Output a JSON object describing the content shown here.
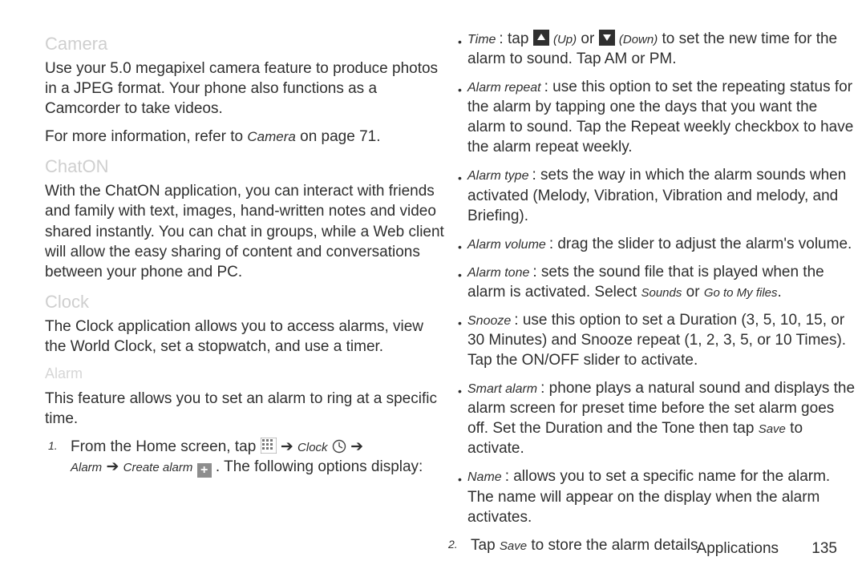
{
  "left": {
    "camera_h": "Camera",
    "camera_p": "Use your 5.0 megapixel camera feature to produce photos in a JPEG format. Your phone also functions as a Camcorder to take videos.",
    "camera_ref_a": "For more information, refer to ",
    "camera_ref_link": "Camera",
    "camera_ref_b": " on page 71.",
    "chaton_h": "ChatON",
    "chaton_p": "With the ChatON application, you can interact with friends and family with text, images, hand-written notes and video shared instantly. You can chat in groups, while a Web client will allow the easy sharing of content and conversations between your phone and PC.",
    "clock_h": "Clock",
    "clock_p": "The Clock application allows you to access alarms, view the World Clock, set a stopwatch, and use a timer.",
    "alarm_h": "Alarm",
    "alarm_p": "This feature allows you to set an alarm to ring at a specific time.",
    "step1_num": "1.",
    "step1_a": "From the Home screen, tap ",
    "step1_clock": "Clock",
    "step1_alarm": "Alarm",
    "step1_arrow": " ➔ ",
    "step1_create": "Create alarm",
    "step1_b": ". The following options display:"
  },
  "right": {
    "time_lead": "Time",
    "time_a": ": tap ",
    "time_up": " (Up)",
    "time_or": " or ",
    "time_down": " (Down)",
    "time_b": " to set the new time for the alarm to sound. Tap AM or PM.",
    "repeat_lead": "Alarm repeat",
    "repeat_body": ": use this option to set the repeating status for the alarm by tapping one the days that you want the alarm to sound. Tap the Repeat weekly checkbox to have the alarm repeat weekly.",
    "type_lead": "Alarm type",
    "type_body": ": sets the way in which the alarm sounds when activated (Melody, Vibration, Vibration and melody, and Briefing).",
    "vol_lead": "Alarm volume",
    "vol_body": ": drag the slider to adjust the alarm's volume.",
    "tone_lead": "Alarm tone",
    "tone_a": ": sets the sound file that is played when the alarm is activated. Select ",
    "tone_sounds": "Sounds",
    "tone_or": " or ",
    "tone_files": "Go to My files",
    "tone_b": ".",
    "snooze_lead": "Snooze",
    "snooze_body": ": use this option to set a Duration (3, 5, 10, 15, or 30 Minutes) and Snooze repeat (1, 2, 3, 5, or 10 Times). Tap the ON/OFF slider to activate.",
    "smart_lead": "Smart alarm",
    "smart_a": ": phone plays a natural sound and displays the alarm screen for preset time before the set alarm goes off. Set the Duration and the Tone then tap ",
    "smart_save": "Save",
    "smart_b": " to activate.",
    "name_lead": "Name",
    "name_body": ": allows you to set a specific name for the alarm. The name will appear on the display when the alarm activates.",
    "step2_num": "2.",
    "step2_a": "Tap ",
    "step2_save": "Save",
    "step2_b": " to store the alarm details."
  },
  "footer": {
    "section": "Applications",
    "page": "135"
  }
}
